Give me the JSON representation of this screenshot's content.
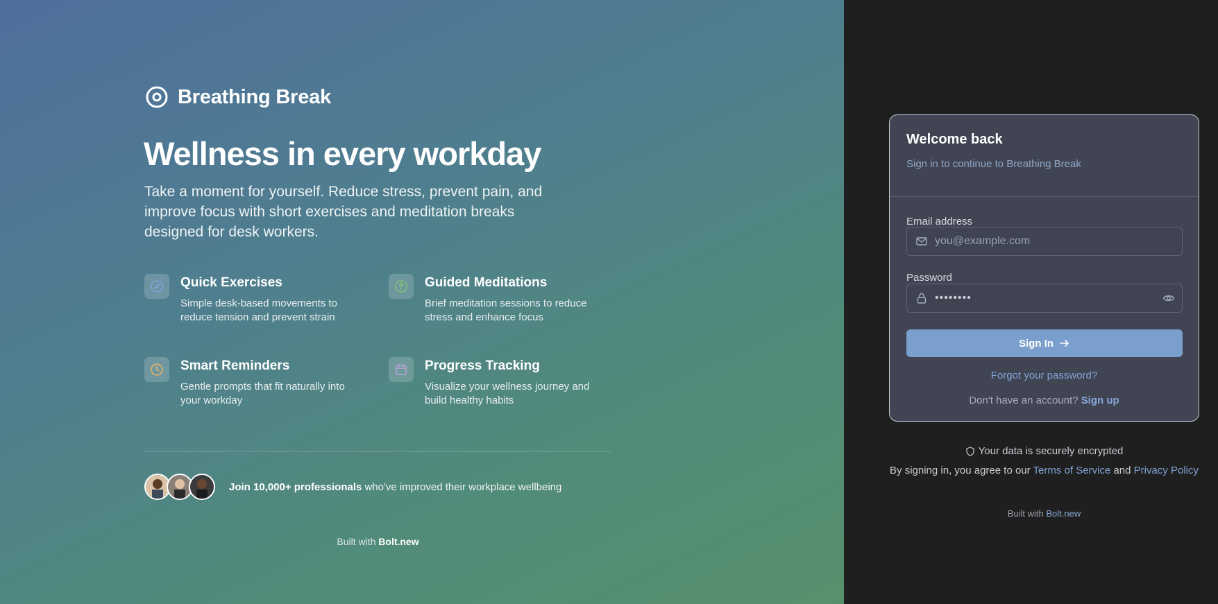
{
  "brand": {
    "name": "Breathing Break"
  },
  "hero": {
    "title": "Wellness in every workday",
    "subtitle": "Take a moment for yourself. Reduce stress, prevent pain, and improve focus with short exercises and meditation breaks designed for desk workers."
  },
  "features": [
    {
      "icon": "compass-icon",
      "title": "Quick Exercises",
      "description": "Simple desk-based movements to reduce tension and prevent strain",
      "color": "#7fa6d8"
    },
    {
      "icon": "leaf-icon",
      "title": "Guided Meditations",
      "description": "Brief meditation sessions to reduce stress and enhance focus",
      "color": "#7ec17a"
    },
    {
      "icon": "clock-icon",
      "title": "Smart Reminders",
      "description": "Gentle prompts that fit naturally into your workday",
      "color": "#e3b56a"
    },
    {
      "icon": "calendar-icon",
      "title": "Progress Tracking",
      "description": "Visualize your wellness journey and build healthy habits",
      "color": "#b9a3dd"
    }
  ],
  "social": {
    "bold": "Join 10,000+ professionals",
    "rest": " who've improved their workplace wellbeing"
  },
  "left_footer": {
    "prefix": "Built with ",
    "link": "Bolt.new"
  },
  "login": {
    "title": "Welcome back",
    "subtitle": "Sign in to continue to Breathing Break",
    "email_label": "Email address",
    "email_placeholder": "you@example.com",
    "password_label": "Password",
    "password_value": "••••••••",
    "sign_in": "Sign In",
    "forgot": "Forgot your password?",
    "no_account": "Don't have an account? ",
    "sign_up": "Sign up"
  },
  "security": {
    "text": "Your data is securely encrypted"
  },
  "terms": {
    "prefix": "By signing in, you agree to our ",
    "tos": "Terms of Service",
    "and": " and ",
    "privacy": "Privacy Policy"
  },
  "right_footer": {
    "prefix": "Built with ",
    "link": "Bolt.new"
  },
  "colors": {
    "accent": "#7a9fcd",
    "card_bg": "#414553",
    "link": "#7fa2d3"
  }
}
